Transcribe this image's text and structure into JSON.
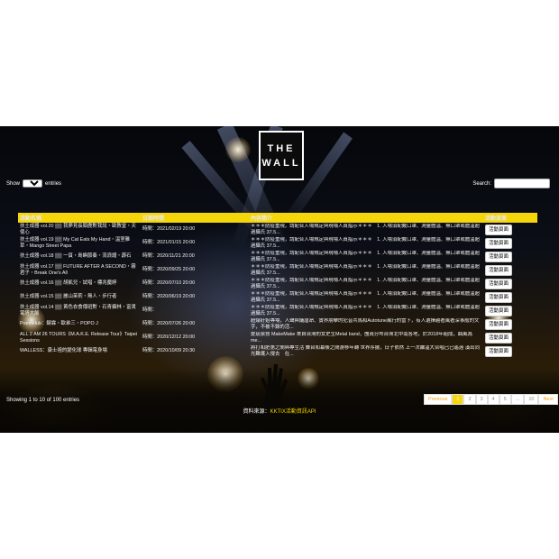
{
  "logo": {
    "line1": "THE",
    "line2": "WALL"
  },
  "length_control": {
    "prefix": "Show",
    "value": "10",
    "suffix": "entries"
  },
  "search": {
    "label": "Search:",
    "value": ""
  },
  "table": {
    "headers": [
      "活動名稱",
      "日期時間",
      "內容簡介",
      "活動頁面"
    ],
    "rows": [
      {
        "name": "扶土成器 vol.20 ▒▒ 我夢見長頸鹿對我說・歐教堂・天使心",
        "date": "時間：2021/02/19 20:00",
        "desc": "＊＊＊防疫重現，請配合入場規定與現場人員指示＊＊＊　1. 入場須配戴口罩、測量體溫、無口罩或體溫超過攝氏 37.5...",
        "btn": "活動頁面"
      },
      {
        "name": "扶土成器 vol.19 ▒▒ My Cat Eats My Hand・溫室雜草・Mango Street Papa",
        "date": "時間：2021/01/15 20:00",
        "desc": "＊＊＊防疫重現，請配合入場規定與現場人員指示＊＊＊　1. 入場須配戴口罩、測量體溫、無口罩或體溫超過攝氏 37.5...",
        "btn": "活動頁面"
      },
      {
        "name": "扶土成器 vol.18 ▒▒ 一頁・島嶼節奏・流浪譜・霹石",
        "date": "時間：2020/11/21 20:00",
        "desc": "＊＊＊防疫重現，請配合入場規定與現場人員指示＊＊＊　1. 入場須配戴口罩、測量體溫、無口罩或體溫超過攝氏 37.5...",
        "btn": "活動頁面"
      },
      {
        "name": "扶土成器 vol.17 ▒▒ FUTURE AFTER A SECOND・霧君子・Break One's All",
        "date": "時間：2020/09/25 20:00",
        "desc": "＊＊＊防疫重現，請配合入場規定與現場人員指示＊＊＊　1. 入場須配戴口罩、測量體溫、無口罩或體溫超過攝氏 37.5...",
        "btn": "活動頁面"
      },
      {
        "name": "扶土成器 vol.16 ▒▒ 胡凱兒・試唱・標兆魔婷",
        "date": "時間：2020/07/10 20:00",
        "desc": "＊＊＊防疫重現，請配合入場規定與現場人員指示＊＊＊　1. 入場須配戴口罩、測量體溫、無口罩或體溫超過攝氏 37.5...",
        "btn": "活動頁面"
      },
      {
        "name": "扶土成器 vol.15 ▒▒ 麗山茉莉・無人・步行者",
        "date": "時間：2020/06/19 20:00",
        "desc": "＊＊＊防疫重現，請配合入場規定與現場人員指示＊＊＊　1. 入場須配戴口罩、測量體溫、無口罩或體溫超過攝氏 37.5...",
        "btn": "活動頁面"
      },
      {
        "name": "扶土成器 vol.14 ▒▒ 黃色衣食傳班對・石青攝林・富貴電塔大飯",
        "date": "時間：",
        "desc": "＊＊＊防疫重現，請配合入場規定與現場人員指示＊＊＊　1. 入場須配戴口罩、測量體溫、無口罩或體溫超過攝氏 37.5...",
        "btn": "活動頁面"
      },
      {
        "name": "PoemHub：鍵霖・歐弟三・POPO J",
        "date": "時間：2020/07/26 20:00",
        "desc": "超爆紆姐專場，人聲與議唐昂、實界朋攀的犯音共馬和Autotune風行的當下，有人選擇越著風著深事般的文字，不被不錄的活...",
        "btn": "活動頁面"
      },
      {
        "name": "ALL 2 AM 26 TOURS《M.A.K.E. Release Tour》Taipei Sessions",
        "date": "時間：2020/12/12 20:00",
        "desc": "愛琉泉技 MakeMake 來自台灣的女史生Metal band，團員分布台灣北中南各地，於2018年組成，曲風為me...",
        "btn": "活動頁面"
      },
      {
        "name": "WALLESS：康士祖的變化球 專輯電身場",
        "date": "時間：2020/10/09 20:30",
        "desc": "將打和肥第之間與專生活 舞台和幕後之間游移年轉 世界序擺，日子依然 上一次離溫大合唱已已遙遠 漢出同光難護入侵去　在...",
        "btn": "活動頁面"
      }
    ]
  },
  "info": "Showing 1 to 10 of 100 entries",
  "pagination": [
    "Previous",
    "1",
    "2",
    "3",
    "4",
    "5",
    "...",
    "10",
    "Next"
  ],
  "footer": {
    "label": "資料來源：",
    "source": "KKTIX活動資訊API"
  }
}
